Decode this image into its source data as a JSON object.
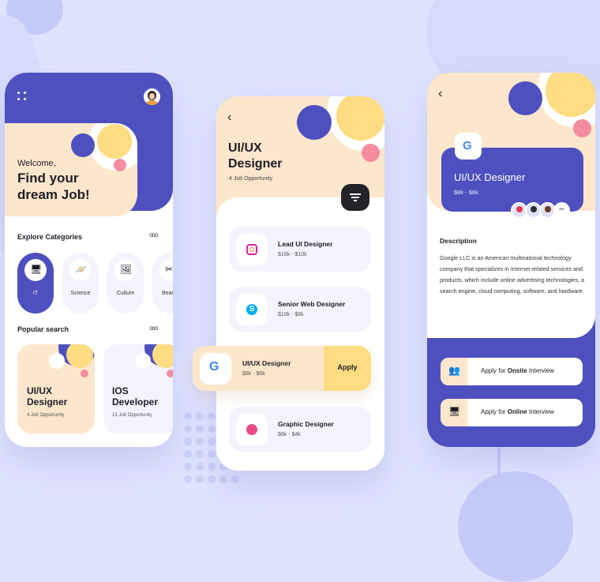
{
  "colors": {
    "primary": "#4e50bf",
    "peach": "#fde7cc",
    "yellow": "#fddc82",
    "pink": "#f68ca0",
    "light": "#f4f4fe",
    "dark": "#232329"
  },
  "screen1": {
    "menu_icon": "grid-dots-icon",
    "avatar_icon": "user-avatar-icon",
    "welcome": "Welcome,",
    "headline_1": "Find your",
    "headline_2": "dream Job!",
    "explore_title": "Explore Categories",
    "more_icon": "more-dots-icon",
    "categories": [
      {
        "label": "IT",
        "icon": "computer-icon",
        "active": true
      },
      {
        "label": "Science",
        "icon": "planet-icon",
        "active": false
      },
      {
        "label": "Culture",
        "icon": "art-icon",
        "active": false
      },
      {
        "label": "Beauty",
        "icon": "scissors-icon",
        "active": false
      }
    ],
    "popular_title": "Popular search",
    "popular": [
      {
        "title_1": "UI/UX",
        "title_2": "Designer",
        "count": "4 Job Opportunity"
      },
      {
        "title_1": "IOS",
        "title_2": "Developer",
        "count": "13 Job Opportunity"
      }
    ]
  },
  "screen2": {
    "back_icon": "chevron-left-icon",
    "title_1": "UI/UX",
    "title_2": "Designer",
    "subtitle": "4 Job Opportunity",
    "filter_icon": "filter-icon",
    "jobs": [
      {
        "title": "Lead UI Designer",
        "salary": "$16k - $10k",
        "icon": "instagram-icon"
      },
      {
        "title": "Senior Web Designer",
        "salary": "$10k - $8k",
        "icon": "skype-icon"
      },
      {
        "title": "UI/UX Designer",
        "salary": "$8k - $6k",
        "icon": "google-icon",
        "apply": "Apply"
      },
      {
        "title": "Graphic Designer",
        "salary": "$6k - $4k",
        "icon": "dribbble-icon"
      }
    ]
  },
  "screen3": {
    "back_icon": "chevron-left-icon",
    "company_icon": "google-icon",
    "job_title": "UI/UX Designer",
    "salary": "$8k - $6k",
    "applicants_more": "•••",
    "description_title": "Description",
    "description": "Google LLC is an American multinational technology company that specializes in Internet-related services and products, which include online advertising technologies, a search engine, cloud computing, software, and hardware.",
    "apply_buttons": [
      {
        "prefix": "Apply for ",
        "bold": "Onsite",
        "suffix": " Interview",
        "icon": "team-meeting-icon"
      },
      {
        "prefix": "Apply for ",
        "bold": "Online",
        "suffix": " Interview",
        "icon": "video-call-icon"
      }
    ]
  }
}
